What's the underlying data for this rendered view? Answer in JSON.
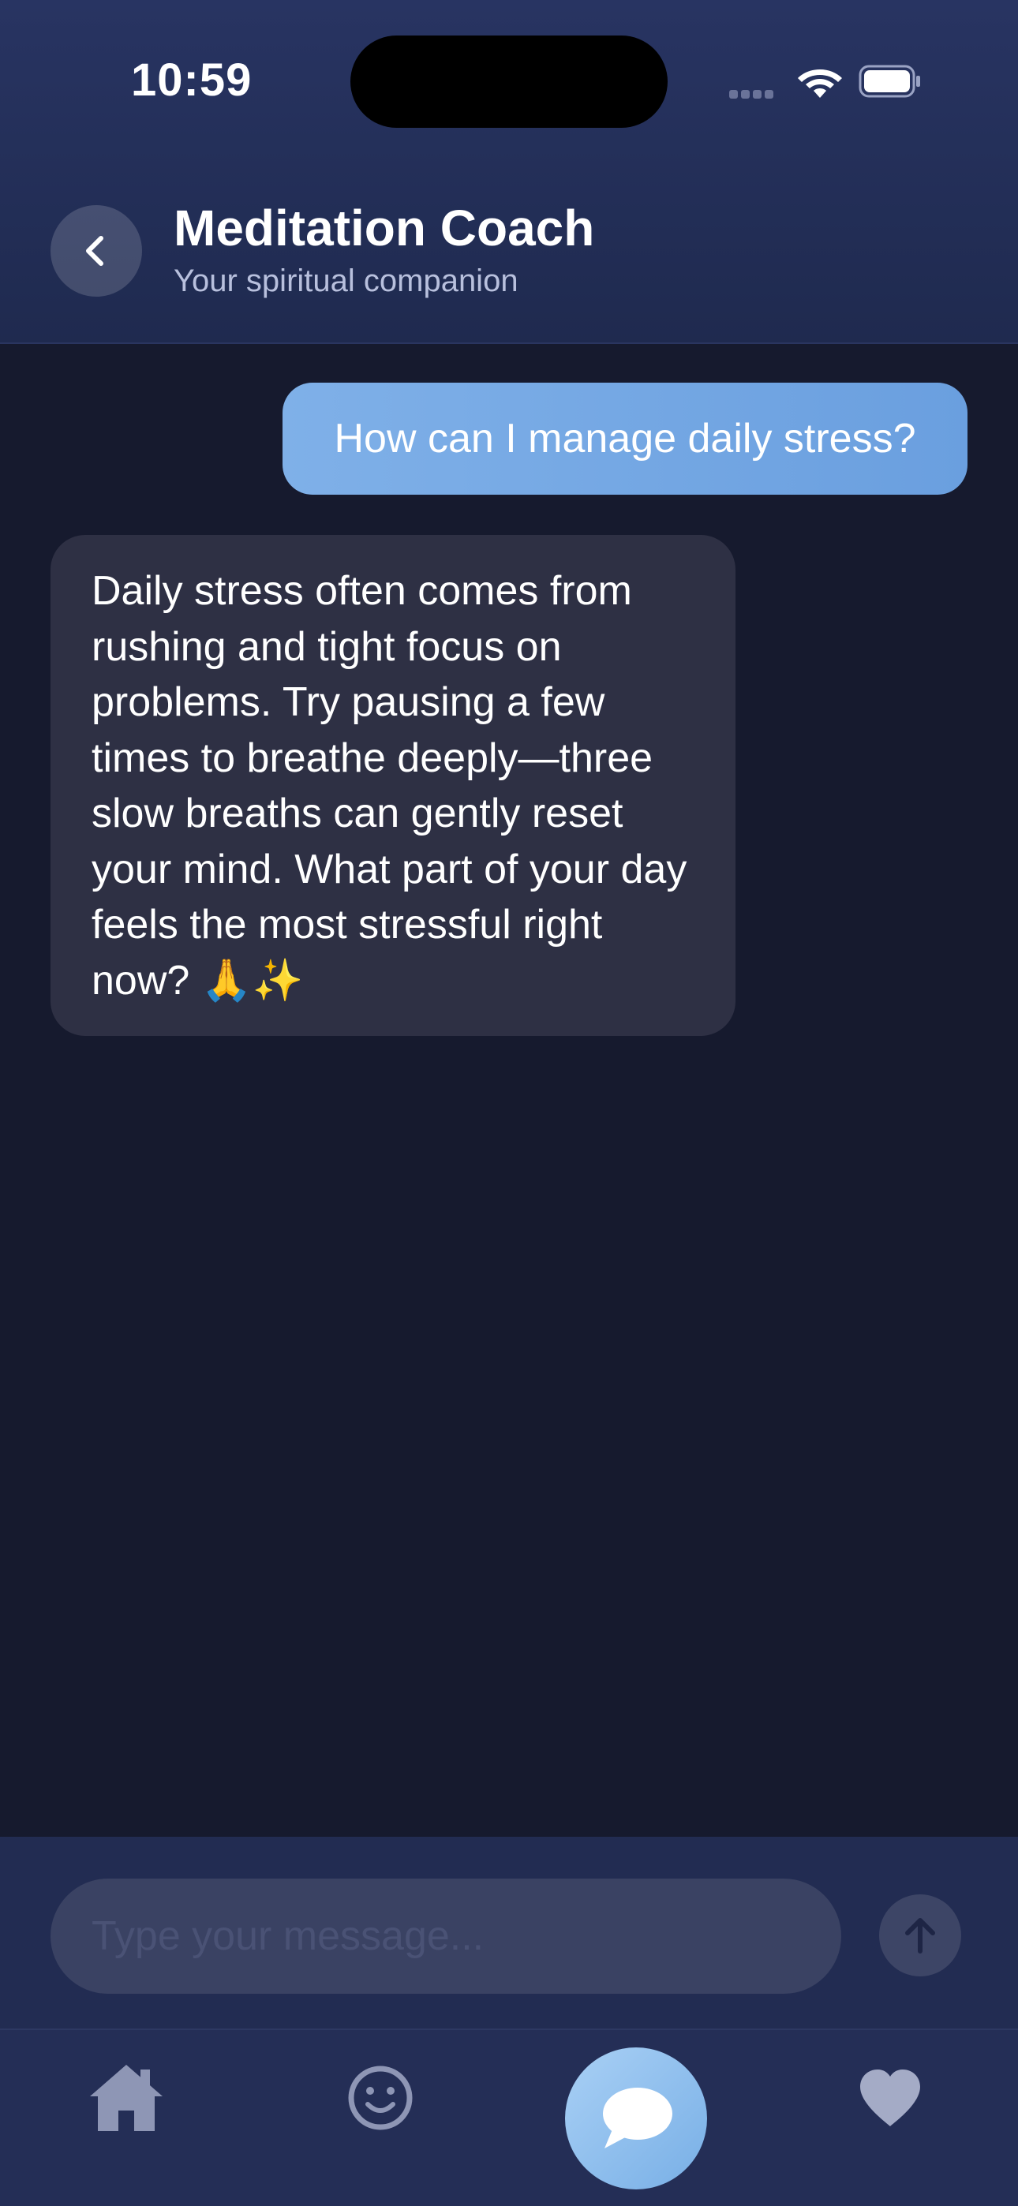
{
  "status_bar": {
    "time": "10:59"
  },
  "header": {
    "title": "Meditation Coach",
    "subtitle": "Your spiritual companion",
    "back_icon": "chevron-left-icon"
  },
  "messages": [
    {
      "sender": "user",
      "text": "How can I manage daily stress?"
    },
    {
      "sender": "coach",
      "text": "Daily stress often comes from rushing and tight focus on problems. Try pausing a few times to breathe deeply—three slow breaths can gently reset your mind. What part of your day feels the most stressful right now? 🙏✨"
    }
  ],
  "composer": {
    "placeholder": "Type your message...",
    "value": "",
    "send_icon": "arrow-up-icon"
  },
  "tab_bar": {
    "items": [
      {
        "icon": "home-icon",
        "active": false
      },
      {
        "icon": "smiley-icon",
        "active": false
      },
      {
        "icon": "chat-bubble-icon",
        "active": true
      },
      {
        "icon": "heart-icon",
        "active": false
      }
    ]
  },
  "colors": {
    "background": "#161a2e",
    "header": "#283462",
    "user_bubble": "#7fb0e8",
    "coach_bubble": "#2e3044",
    "active_tab": "#a9d0f5"
  }
}
